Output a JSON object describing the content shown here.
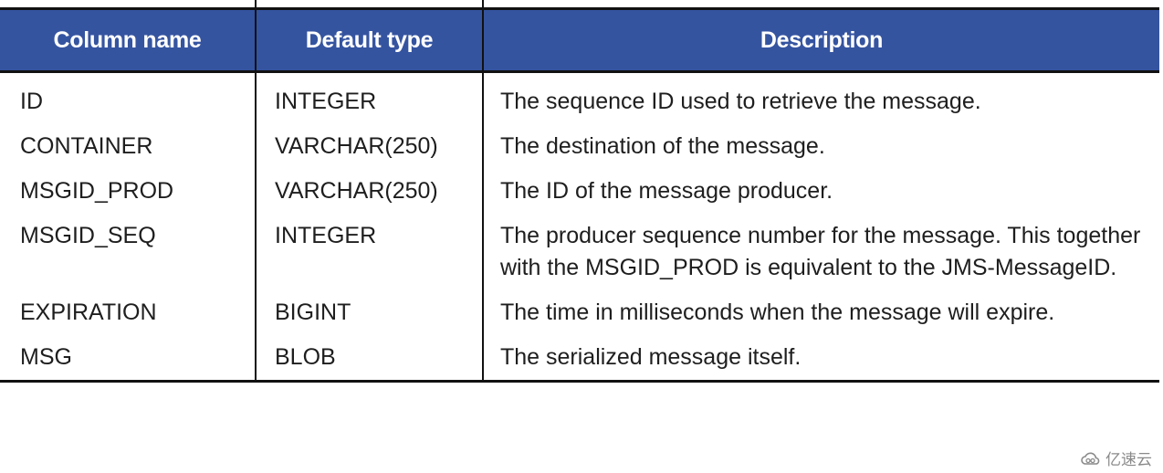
{
  "table": {
    "headers": [
      "Column name",
      "Default type",
      "Description"
    ],
    "rows": [
      {
        "column": "ID",
        "type": "INTEGER",
        "description": "The sequence ID used to retrieve the message."
      },
      {
        "column": "CONTAINER",
        "type": "VARCHAR(250)",
        "description": "The destination of the message."
      },
      {
        "column": "MSGID_PROD",
        "type": "VARCHAR(250)",
        "description": "The ID of the message producer."
      },
      {
        "column": "MSGID_SEQ",
        "type": "INTEGER",
        "description": "The producer sequence number for the message. This together with the MSGID_PROD is equivalent to the JMS-MessageID."
      },
      {
        "column": "EXPIRATION",
        "type": "BIGINT",
        "description": "The time in milliseconds when the message will expire."
      },
      {
        "column": "MSG",
        "type": "BLOB",
        "description": "The serialized message itself."
      }
    ],
    "header_color": "#3554a0"
  },
  "watermark": {
    "text": "亿速云",
    "icon": "cloud-logo-icon"
  }
}
